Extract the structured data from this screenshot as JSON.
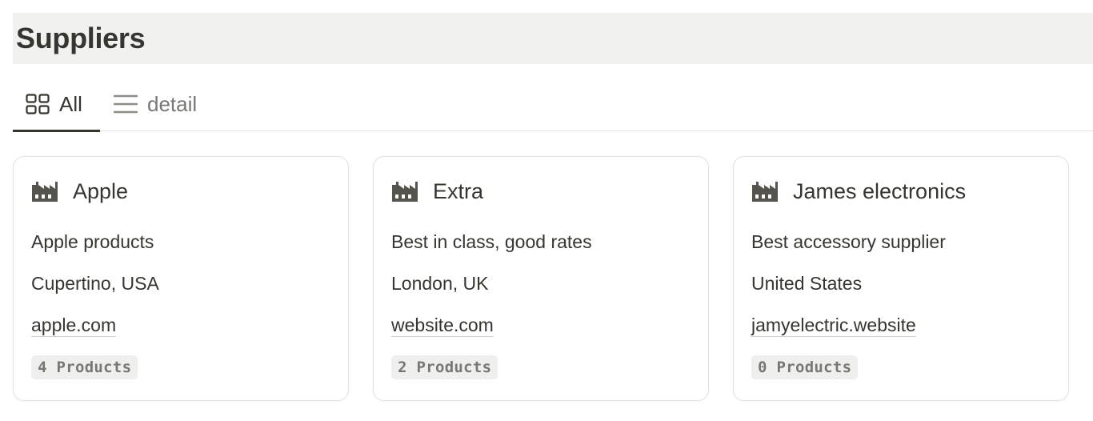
{
  "page": {
    "title": "Suppliers"
  },
  "tabs": [
    {
      "label": "All",
      "icon": "gallery-grid-icon",
      "active": true
    },
    {
      "label": "detail",
      "icon": "list-icon",
      "active": false
    }
  ],
  "suppliers": [
    {
      "icon": "factory-icon",
      "name": "Apple",
      "description": "Apple products",
      "location": "Cupertino, USA",
      "website": "apple.com",
      "products": "4 Products"
    },
    {
      "icon": "factory-icon",
      "name": "Extra",
      "description": "Best in class, good rates",
      "location": "London, UK",
      "website": "website.com",
      "products": "2 Products"
    },
    {
      "icon": "factory-icon",
      "name": "James electronics",
      "description": "Best accessory supplier",
      "location": "United States",
      "website": "jamyelectric.website",
      "products": "0 Products"
    }
  ],
  "colors": {
    "text": "#37352f",
    "muted": "#787774",
    "title_bg": "#f1f1ef",
    "border": "#e3e2e0",
    "badge_bg": "#efefed",
    "icon": "#55534e"
  }
}
